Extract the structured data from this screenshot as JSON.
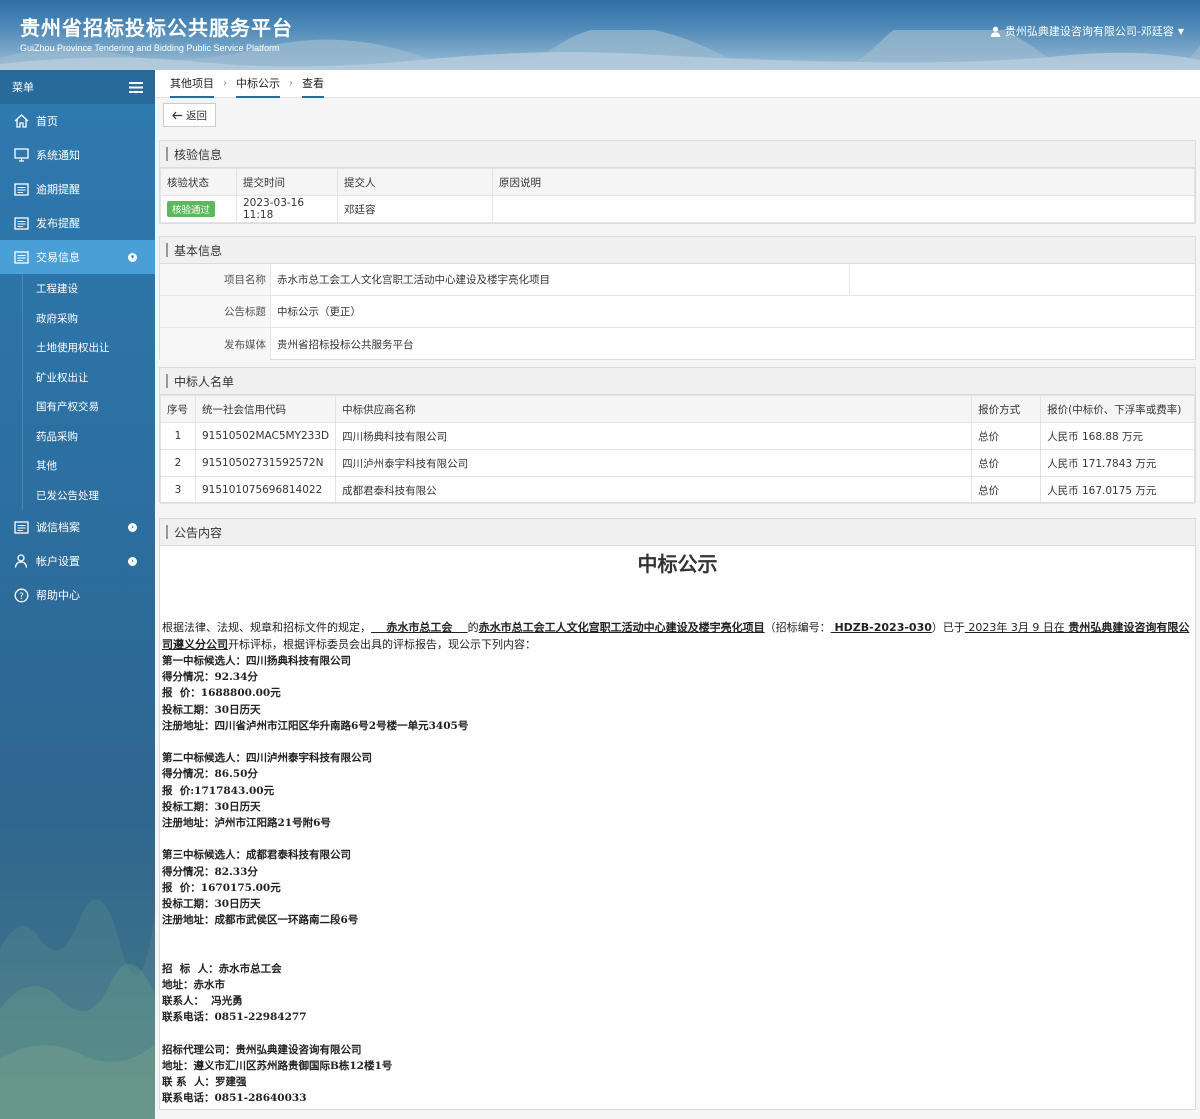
{
  "header": {
    "title": "贵州省招标投标公共服务平台",
    "subtitle": "GuiZhou Province Tendering and Bidding Public Service Platform",
    "user": "贵州弘典建设咨询有限公司-邓廷容"
  },
  "sidebar": {
    "menu_label": "菜单",
    "items": [
      {
        "label": "首页",
        "icon": "home-icon"
      },
      {
        "label": "系统通知",
        "icon": "monitor-icon"
      },
      {
        "label": "逾期提醒",
        "icon": "list-icon"
      },
      {
        "label": "发布提醒",
        "icon": "list-icon"
      },
      {
        "label": "交易信息",
        "icon": "list-icon"
      }
    ],
    "sub_items": [
      "工程建设",
      "政府采购",
      "土地使用权出让",
      "矿业权出让",
      "国有产权交易",
      "药品采购",
      "其他",
      "已发公告处理"
    ],
    "bottom_items": [
      {
        "label": "诚信档案",
        "icon": "list-icon"
      },
      {
        "label": "帐户设置",
        "icon": "user-icon"
      },
      {
        "label": "帮助中心",
        "icon": "help-icon"
      }
    ]
  },
  "breadcrumb": [
    "其他项目",
    "中标公示",
    "查看"
  ],
  "toolbar": {
    "back_label": "返回"
  },
  "verify": {
    "title": "核验信息",
    "headers": [
      "核验状态",
      "提交时间",
      "提交人",
      "原因说明"
    ],
    "status": "核验通过",
    "time": "2023-03-16 11:18",
    "submitter": "邓廷容",
    "reason": ""
  },
  "basic": {
    "title": "基本信息",
    "rows": [
      {
        "label": "项目名称",
        "value": "赤水市总工会工人文化宫职工活动中心建设及楼宇亮化项目"
      },
      {
        "label": "公告标题",
        "value": "中标公示（更正）"
      },
      {
        "label": "发布媒体",
        "value": "贵州省招标投标公共服务平台"
      }
    ]
  },
  "winners": {
    "title": "中标人名单",
    "headers": [
      "序号",
      "统一社会信用代码",
      "中标供应商名称",
      "报价方式",
      "报价(中标价、下浮率或费率)"
    ],
    "rows": [
      {
        "no": "1",
        "code": "91510502MAC5MY233D",
        "name": "四川杨典科技有限公司",
        "method": "总价",
        "price": "人民币 168.88 万元"
      },
      {
        "no": "2",
        "code": "91510502731592572N",
        "name": "四川泸州泰宇科技有限公司",
        "method": "总价",
        "price": "人民币 171.7843 万元"
      },
      {
        "no": "3",
        "code": "915101075696814022",
        "name": "成都君泰科技有限公",
        "method": "总价",
        "price": "人民币 167.0175 万元"
      }
    ]
  },
  "notice": {
    "panel_title": "公告内容",
    "heading": "中标公示",
    "intro_a": "根据法律、法规、规章和招标文件的规定，",
    "intro_owner": "    赤水市总工会    ",
    "intro_b": "的",
    "intro_project": "赤水市总工会工人文化宫职工活动中心建设及楼宇亮化项目",
    "intro_c": "（招标编号：",
    "intro_code": " HDZB-2023-030",
    "intro_d": "）已于",
    "intro_date": " 2023年 3月 9 日在 ",
    "intro_place": "贵州弘典建设咨询有限公司遵义分公司",
    "intro_e": "开标评标，根据评标委员会出具的评标报告，现公示下列内容：",
    "lines_1": [
      "第一中标候选人：四川扬典科技有限公司",
      "得分情况：92.34分",
      "报  价：1688800.00元",
      "投标工期：30日历天",
      "注册地址：四川省泸州市江阳区华升南路6号2号楼一单元3405号"
    ],
    "lines_2": [
      "第二中标候选人：四川泸州泰宇科技有限公司",
      "得分情况：86.50分",
      "报  价:1717843.00元",
      "投标工期：30日历天",
      "注册地址：泸州市江阳路21号附6号"
    ],
    "lines_3": [
      "第三中标候选人：成都君泰科技有限公司",
      "得分情况：82.33分",
      "报  价：1670175.00元",
      "投标工期：30日历天",
      "注册地址：成都市武侯区一环路南二段6号"
    ],
    "lines_4": [
      "招  标  人：赤水市总工会",
      "地址：赤水市",
      "联系人：  冯光勇",
      "联系电话：0851-22984277"
    ],
    "lines_5": [
      "招标代理公司：贵州弘典建设咨询有限公司",
      "地址：遵义市汇川区苏州路贵御国际B栋12楼1号",
      "联 系  人：罗建强",
      "联系电话：0851-28640033"
    ]
  }
}
